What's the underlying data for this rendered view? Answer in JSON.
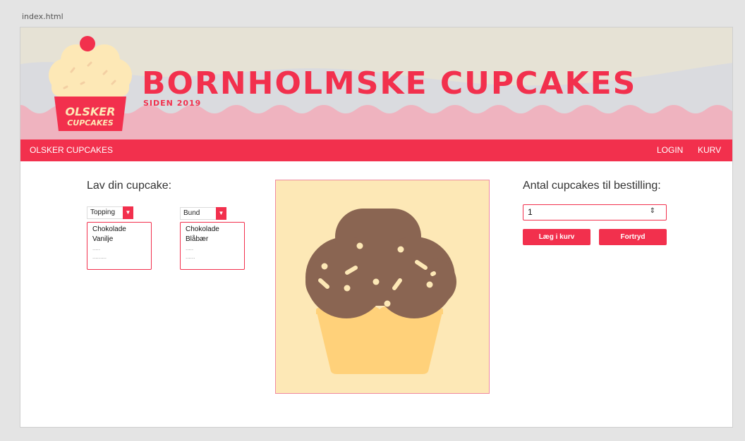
{
  "file_tab": "index.html",
  "logo": {
    "line1": "OLSKER",
    "line2": "CUPCAKES"
  },
  "header": {
    "title": "BORNHOLMSKE CUPCAKES",
    "subtitle": "SIDEN 2019"
  },
  "nav": {
    "brand": "OLSKER CUPCAKES",
    "login": "LOGIN",
    "cart": "KURV"
  },
  "builder": {
    "heading": "Lav din cupcake:",
    "topping": {
      "selected": "Topping",
      "options": [
        "Chokolade",
        "Vanilje",
        ".....",
        "........."
      ]
    },
    "bottom": {
      "selected": "Bund",
      "options": [
        "Chokolade",
        "Blåbær",
        ".....",
        "......"
      ]
    }
  },
  "order": {
    "heading": "Antal cupcakes til bestilling:",
    "quantity": "1",
    "add_label": "Læg i kurv",
    "cancel_label": "Fortryd"
  },
  "colors": {
    "accent": "#f2304d",
    "cream": "#fde8b6",
    "chocolate": "#8a6552",
    "wrapper": "#ffd17a"
  }
}
